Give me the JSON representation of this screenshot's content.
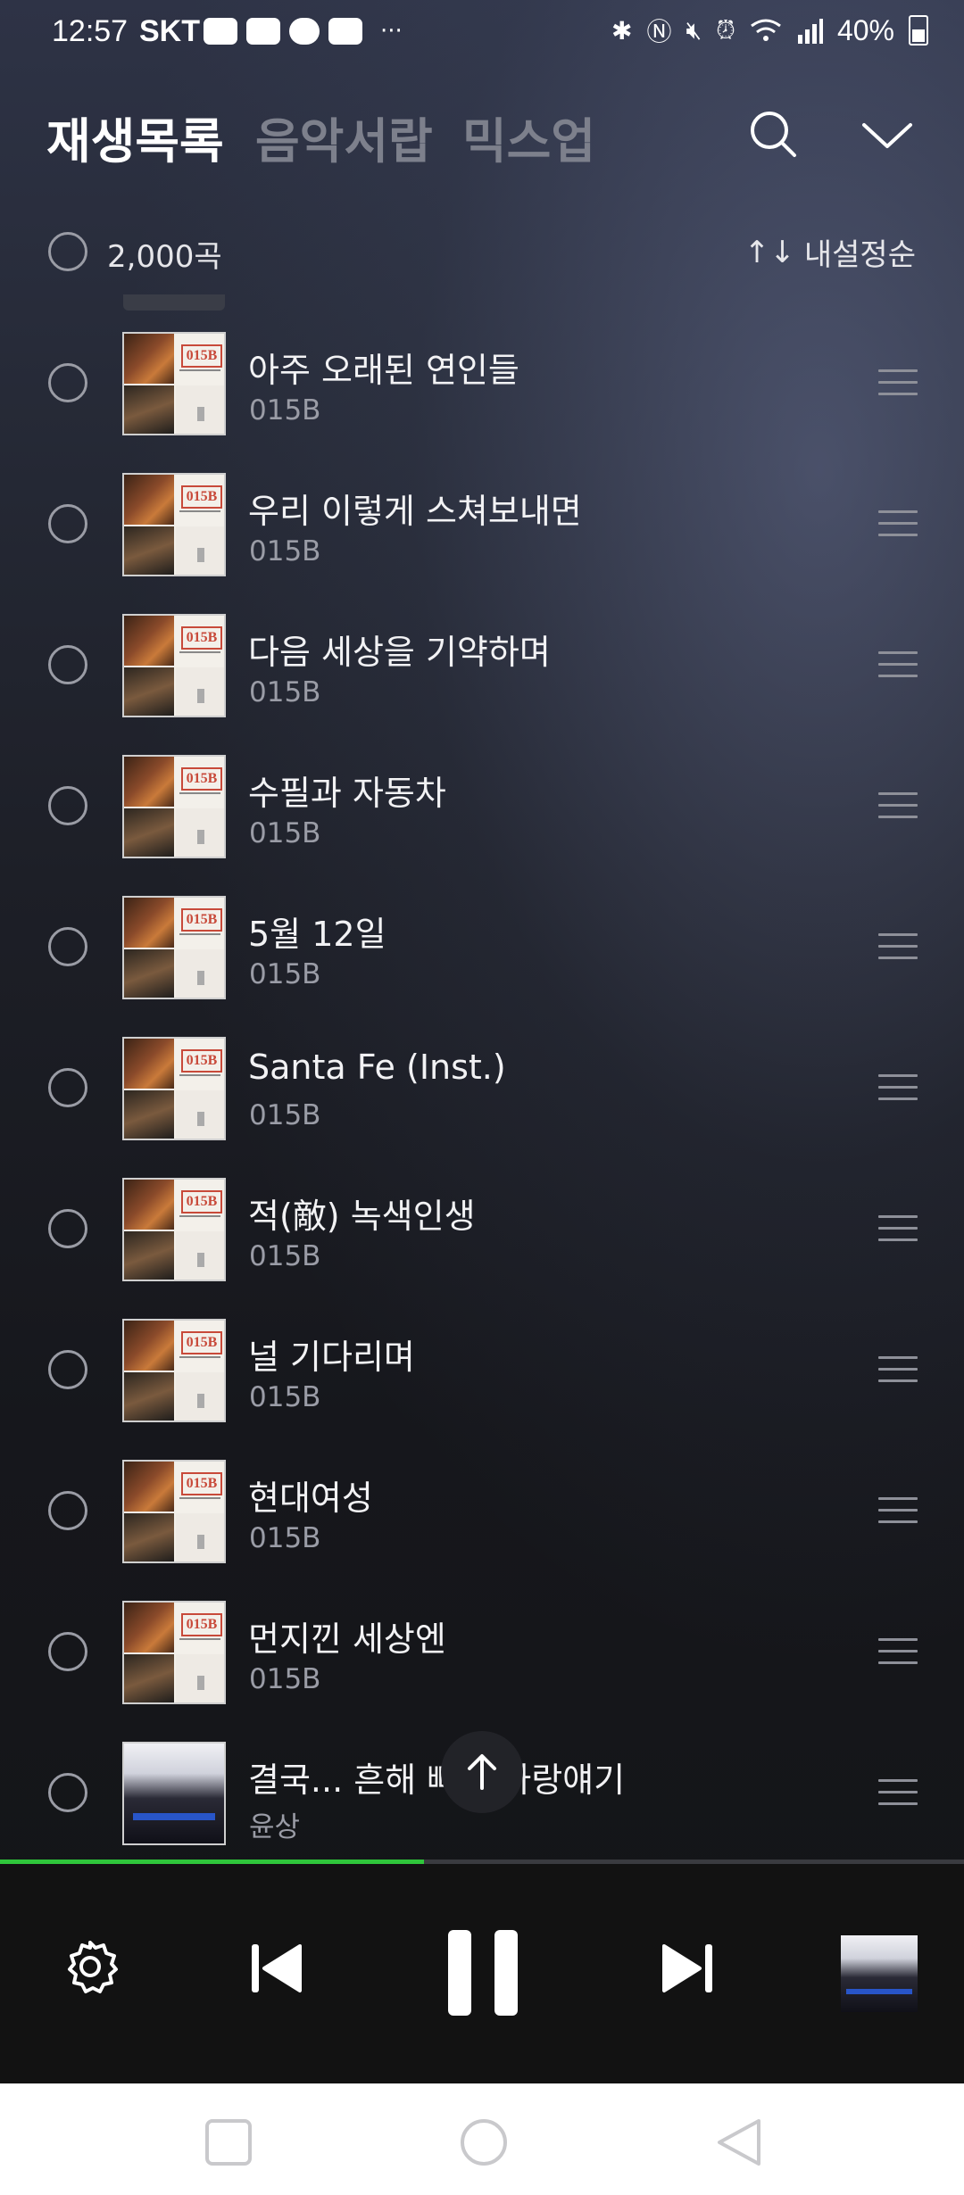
{
  "status_bar": {
    "time": "12:57",
    "carrier": "SKT",
    "dots": "···",
    "battery": "40%"
  },
  "header": {
    "tabs": [
      {
        "label": "재생목록",
        "active": true
      },
      {
        "label": "음악서랍",
        "active": false
      },
      {
        "label": "믹스업",
        "active": false
      }
    ],
    "search_icon": "search-icon",
    "collapse_icon": "chevron-down-icon"
  },
  "selection": {
    "count": "2,000곡",
    "sort_label": "내설정순",
    "sort_icon": "↑↓"
  },
  "songs": [
    {
      "title": "아주 오래된 연인들",
      "artist": "015B"
    },
    {
      "title": "우리 이렇게 스쳐보내면",
      "artist": "015B"
    },
    {
      "title": "다음 세상을 기약하며",
      "artist": "015B"
    },
    {
      "title": "수필과 자동차",
      "artist": "015B"
    },
    {
      "title": "5월 12일",
      "artist": "015B"
    },
    {
      "title": "Santa Fe (Inst.)",
      "artist": "015B"
    },
    {
      "title": "적(敵) 녹색인생",
      "artist": "015B"
    },
    {
      "title": "널 기다리며",
      "artist": "015B"
    },
    {
      "title": "현대여성",
      "artist": "015B"
    },
    {
      "title": "먼지낀 세상엔",
      "artist": "015B"
    },
    {
      "title": "결국... 흔해 빠진 사랑얘기",
      "artist": "윤상"
    }
  ],
  "album_logo_text": "015B",
  "player": {
    "progress_fraction": 0.44,
    "progress_color": "#2fc63b"
  }
}
